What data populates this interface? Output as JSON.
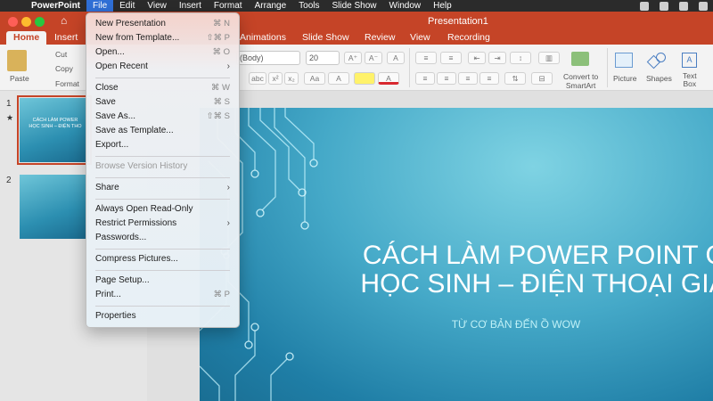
{
  "menubar": {
    "app_name": "PowerPoint",
    "items": [
      "File",
      "Edit",
      "View",
      "Insert",
      "Format",
      "Arrange",
      "Tools",
      "Slide Show",
      "Window",
      "Help"
    ],
    "active": "File"
  },
  "window": {
    "title": "Presentation1",
    "tabs": [
      "Home",
      "Insert",
      "Animations",
      "Slide Show",
      "Review",
      "View",
      "Recording"
    ],
    "selected_tab": "Home"
  },
  "ribbon": {
    "paste_label": "Paste",
    "cut_label": "Cut",
    "copy_label": "Copy",
    "format_label": "Format",
    "font_name": "(Body)",
    "font_size": "20",
    "convert_smartart_label": "Convert to\nSmartArt",
    "picture_label": "Picture",
    "shapes_label": "Shapes",
    "textbox_label": "Text\nBox"
  },
  "file_menu": {
    "items": [
      {
        "label": "New Presentation",
        "shortcut": "⌘ N"
      },
      {
        "label": "New from Template...",
        "shortcut": "⇧⌘ P"
      },
      {
        "label": "Open...",
        "shortcut": "⌘ O"
      },
      {
        "label": "Open Recent",
        "submenu": true
      },
      {
        "separator": true
      },
      {
        "label": "Close",
        "shortcut": "⌘ W"
      },
      {
        "label": "Save",
        "shortcut": "⌘ S"
      },
      {
        "label": "Save As...",
        "shortcut": "⇧⌘ S"
      },
      {
        "label": "Save as Template..."
      },
      {
        "label": "Export..."
      },
      {
        "separator": true
      },
      {
        "label": "Browse Version History",
        "disabled": true
      },
      {
        "separator": true
      },
      {
        "label": "Share",
        "submenu": true
      },
      {
        "separator": true
      },
      {
        "label": "Always Open Read-Only"
      },
      {
        "label": "Restrict Permissions",
        "submenu": true
      },
      {
        "label": "Passwords..."
      },
      {
        "separator": true
      },
      {
        "label": "Compress Pictures..."
      },
      {
        "separator": true
      },
      {
        "label": "Page Setup..."
      },
      {
        "label": "Print...",
        "shortcut": "⌘ P"
      },
      {
        "separator": true
      },
      {
        "label": "Properties"
      }
    ]
  },
  "thumbnails": [
    {
      "number": "1",
      "text": "CÁCH LÀM POWER\nHỌC SINH – ĐIỆN THO",
      "selected": true
    },
    {
      "number": "2",
      "text": ""
    }
  ],
  "slide": {
    "title": "CÁCH LÀM POWER POINT C\nHỌC SINH – ĐIỆN THOẠI GIÁ",
    "subtitle": "TỪ CƠ BẢN ĐẾN Ồ WOW"
  },
  "colors": {
    "accent": "#c54427",
    "menu_highlight": "#2f6fd6",
    "slide_teal": "#45a9c8"
  }
}
